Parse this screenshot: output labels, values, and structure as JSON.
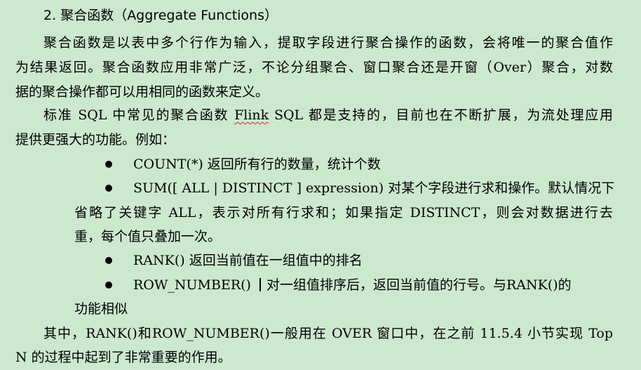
{
  "section": {
    "number": "2.",
    "title": "聚合函数（Aggregate Functions）"
  },
  "paragraph1": {
    "lines": [
      "聚合函数是以表中多个行作为输入，提取字段进行聚合操作的函数，会将唯一的聚合值作",
      "为结果返回。聚合函数应用非常广泛，不论分组聚合、窗口聚合还是开窗（Over）聚合，对数",
      "据的聚合操作都可以用相同的函数来定义。"
    ]
  },
  "paragraph2": {
    "line1_before": "标准 SQL 中常见的聚合函数 ",
    "line1_flagged": "Flink",
    "line1_after": " SQL 都是支持的，目前也在不断扩展，为流处理应用",
    "line2": "提供更强大的功能。例如："
  },
  "bullets": [
    {
      "lines": [
        "COUNT(*)   返回所有行的数量，统计个数"
      ]
    },
    {
      "lines": [
        "SUM([ ALL | DISTINCT ] expression) 对某个字段进行求和操作。默认情况下",
        "省略了关键字 ALL，表示对所有行求和；如果指定 DISTINCT，则会对数据进行去",
        "重，每个值只叠加一次。"
      ]
    },
    {
      "lines": [
        "RANK()    返回当前值在一组值中的排名"
      ]
    },
    {
      "term": "ROW_NUMBER()",
      "rest": "对一组值排序后，返回当前值的行号。与RANK()的",
      "line2": "功能相似"
    }
  ],
  "paragraph3": {
    "lines": [
      "其中，RANK()和ROW_NUMBER()一般用在 OVER 窗口中，在之前 11.5.4 小节实现 Top",
      "N 的过程中起到了非常重要的作用。"
    ]
  },
  "colors": {
    "background": "#cce8cf",
    "text": "#000000",
    "spellcheck_underline": "#d32f2f"
  }
}
